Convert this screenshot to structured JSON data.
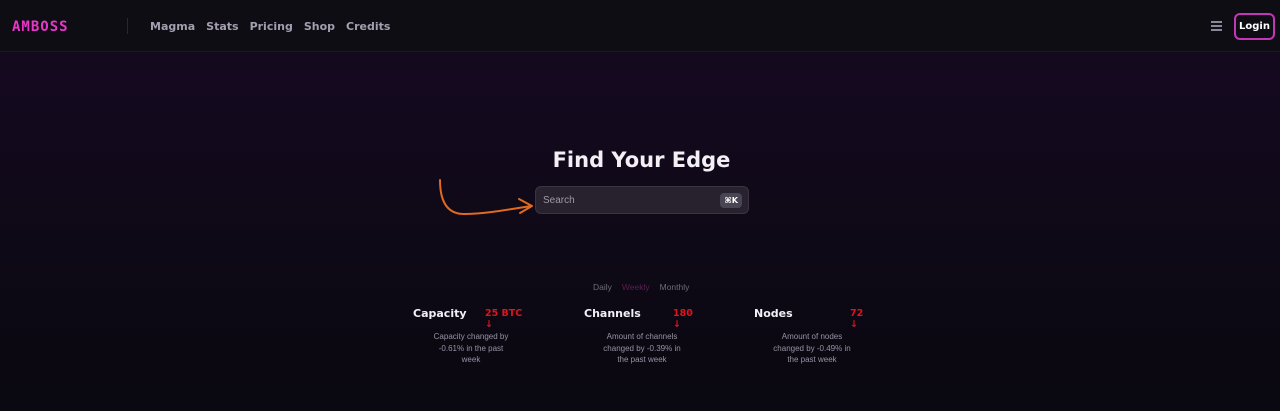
{
  "header": {
    "logo": "AMBOSS",
    "nav": [
      "Magma",
      "Stats",
      "Pricing",
      "Shop",
      "Credits"
    ],
    "login_label": "Login"
  },
  "hero": {
    "title": "Find Your Edge",
    "search_placeholder": "Search",
    "shortcut": "⌘K"
  },
  "tabs": {
    "items": [
      "Daily",
      "Weekly",
      "Monthly"
    ],
    "active": "Weekly"
  },
  "stats": [
    {
      "name": "Capacity",
      "value": "25 BTC",
      "desc": "Capacity changed by -0.61% in the past week"
    },
    {
      "name": "Channels",
      "value": "180",
      "desc": "Amount of channels changed by -0.39% in the past week"
    },
    {
      "name": "Nodes",
      "value": "72",
      "desc": "Amount of nodes changed by -0.49% in the past week"
    }
  ],
  "colors": {
    "brand": "#e837c8",
    "accent_border": "#c236b8",
    "negative": "#e0141b",
    "annotation_arrow": "#e06a1f"
  }
}
